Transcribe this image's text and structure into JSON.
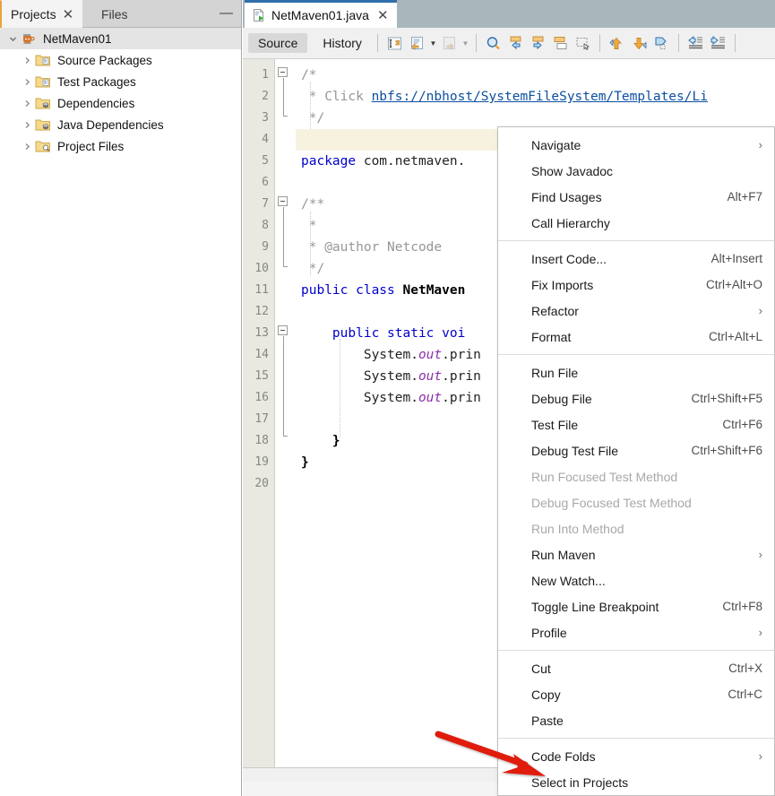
{
  "left_panel": {
    "tabs": [
      {
        "label": "Projects",
        "active": true,
        "closable": true
      },
      {
        "label": "Files",
        "active": false,
        "closable": false
      }
    ],
    "minimize_label": "—",
    "tree": {
      "root": {
        "label": "NetMaven01",
        "icon": "java-maven-project-icon",
        "expanded": true,
        "selected": true
      },
      "children": [
        {
          "label": "Source Packages",
          "icon": "source-packages-folder-icon",
          "expanded": false
        },
        {
          "label": "Test Packages",
          "icon": "test-packages-folder-icon",
          "expanded": false
        },
        {
          "label": "Dependencies",
          "icon": "dependencies-folder-icon",
          "expanded": false
        },
        {
          "label": "Java Dependencies",
          "icon": "java-dependencies-folder-icon",
          "expanded": false
        },
        {
          "label": "Project Files",
          "icon": "project-files-folder-icon",
          "expanded": false
        }
      ]
    }
  },
  "editor": {
    "tab": {
      "filename": "NetMaven01.java",
      "icon": "java-file-icon",
      "close_label": "×",
      "active": true
    },
    "toolbar": {
      "views": [
        {
          "label": "Source",
          "active": true
        },
        {
          "label": "History",
          "active": false
        }
      ],
      "icons": [
        {
          "name": "last-edit-icon",
          "disabled": false
        },
        {
          "name": "back-in-editor-icon",
          "disabled": false
        },
        {
          "name": "forward-in-editor-icon",
          "disabled": true
        },
        {
          "name": "find-selection-icon",
          "disabled": false
        },
        {
          "name": "find-previous-icon",
          "disabled": false
        },
        {
          "name": "find-next-icon",
          "disabled": false
        },
        {
          "name": "toggle-rect-selection-icon",
          "disabled": false
        },
        {
          "name": "previous-bookmark-icon",
          "disabled": false
        },
        {
          "name": "next-bookmark-icon",
          "disabled": false
        },
        {
          "name": "toggle-bookmark-icon",
          "disabled": false
        },
        {
          "name": "shift-line-left-icon",
          "disabled": false
        },
        {
          "name": "shift-line-right-icon",
          "disabled": false
        }
      ]
    },
    "gutter": {
      "line_numbers": [
        "1",
        "2",
        "3",
        "4",
        "5",
        "6",
        "7",
        "8",
        "9",
        "10",
        "11",
        "12",
        "13",
        "14",
        "15",
        "16",
        "17",
        "18",
        "19",
        "20"
      ]
    },
    "current_line": 4,
    "code_lines": [
      {
        "n": 1,
        "tokens": [
          {
            "t": "/*",
            "c": "cmt"
          }
        ]
      },
      {
        "n": 2,
        "tokens": [
          {
            "t": " * Click ",
            "c": "cmt"
          },
          {
            "t": "nbfs://nbhost/SystemFileSystem/Templates/Li",
            "c": "lnk"
          }
        ]
      },
      {
        "n": 3,
        "tokens": [
          {
            "t": " */",
            "c": "cmt"
          }
        ]
      },
      {
        "n": 4,
        "tokens": []
      },
      {
        "n": 5,
        "tokens": [
          {
            "t": "package",
            "c": "kw"
          },
          {
            "t": " com.netmaven.",
            "c": "plain"
          }
        ]
      },
      {
        "n": 6,
        "tokens": []
      },
      {
        "n": 7,
        "tokens": [
          {
            "t": "/**",
            "c": "cmt"
          }
        ]
      },
      {
        "n": 8,
        "tokens": [
          {
            "t": " *",
            "c": "cmt"
          }
        ]
      },
      {
        "n": 9,
        "tokens": [
          {
            "t": " * @author Netcode",
            "c": "cmt"
          }
        ]
      },
      {
        "n": 10,
        "tokens": [
          {
            "t": " */",
            "c": "cmt"
          }
        ]
      },
      {
        "n": 11,
        "tokens": [
          {
            "t": "public class ",
            "c": "kw"
          },
          {
            "t": "NetMaven",
            "c": "bold"
          }
        ]
      },
      {
        "n": 12,
        "tokens": []
      },
      {
        "n": 13,
        "tokens": [
          {
            "t": "    ",
            "c": "plain"
          },
          {
            "t": "public static voi",
            "c": "kw"
          }
        ]
      },
      {
        "n": 14,
        "tokens": [
          {
            "t": "        System.",
            "c": "plain"
          },
          {
            "t": "out",
            "c": "fld"
          },
          {
            "t": ".prin",
            "c": "plain"
          }
        ]
      },
      {
        "n": 15,
        "tokens": [
          {
            "t": "        System.",
            "c": "plain"
          },
          {
            "t": "out",
            "c": "fld"
          },
          {
            "t": ".prin",
            "c": "plain"
          }
        ]
      },
      {
        "n": 16,
        "tokens": [
          {
            "t": "        System.",
            "c": "plain"
          },
          {
            "t": "out",
            "c": "fld"
          },
          {
            "t": ".prin",
            "c": "plain"
          }
        ]
      },
      {
        "n": 17,
        "tokens": []
      },
      {
        "n": 18,
        "tokens": [
          {
            "t": "    }",
            "c": "bold"
          }
        ]
      },
      {
        "n": 19,
        "tokens": [
          {
            "t": "}",
            "c": "bold"
          }
        ]
      },
      {
        "n": 20,
        "tokens": []
      }
    ]
  },
  "context_menu": {
    "groups": [
      {
        "items": [
          {
            "label": "Navigate",
            "accel": "",
            "submenu": true,
            "disabled": false
          },
          {
            "label": "Show Javadoc",
            "accel": "",
            "submenu": false,
            "disabled": false
          },
          {
            "label": "Find Usages",
            "accel": "Alt+F7",
            "submenu": false,
            "disabled": false
          },
          {
            "label": "Call Hierarchy",
            "accel": "",
            "submenu": false,
            "disabled": false
          }
        ]
      },
      {
        "items": [
          {
            "label": "Insert Code...",
            "accel": "Alt+Insert",
            "submenu": false,
            "disabled": false
          },
          {
            "label": "Fix Imports",
            "accel": "Ctrl+Alt+O",
            "submenu": false,
            "disabled": false
          },
          {
            "label": "Refactor",
            "accel": "",
            "submenu": true,
            "disabled": false
          },
          {
            "label": "Format",
            "accel": "Ctrl+Alt+L",
            "submenu": false,
            "disabled": false
          }
        ]
      },
      {
        "items": [
          {
            "label": "Run File",
            "accel": "",
            "submenu": false,
            "disabled": false
          },
          {
            "label": "Debug File",
            "accel": "Ctrl+Shift+F5",
            "submenu": false,
            "disabled": false
          },
          {
            "label": "Test File",
            "accel": "Ctrl+F6",
            "submenu": false,
            "disabled": false
          },
          {
            "label": "Debug Test File",
            "accel": "Ctrl+Shift+F6",
            "submenu": false,
            "disabled": false
          },
          {
            "label": "Run Focused Test Method",
            "accel": "",
            "submenu": false,
            "disabled": true
          },
          {
            "label": "Debug Focused Test Method",
            "accel": "",
            "submenu": false,
            "disabled": true
          },
          {
            "label": "Run Into Method",
            "accel": "",
            "submenu": false,
            "disabled": true
          },
          {
            "label": "Run Maven",
            "accel": "",
            "submenu": true,
            "disabled": false
          },
          {
            "label": "New Watch...",
            "accel": "",
            "submenu": false,
            "disabled": false
          },
          {
            "label": "Toggle Line Breakpoint",
            "accel": "Ctrl+F8",
            "submenu": false,
            "disabled": false
          },
          {
            "label": "Profile",
            "accel": "",
            "submenu": true,
            "disabled": false
          }
        ]
      },
      {
        "items": [
          {
            "label": "Cut",
            "accel": "Ctrl+X",
            "submenu": false,
            "disabled": false
          },
          {
            "label": "Copy",
            "accel": "Ctrl+C",
            "submenu": false,
            "disabled": false
          },
          {
            "label": "Paste",
            "accel": "",
            "submenu": false,
            "disabled": false
          }
        ]
      },
      {
        "items": [
          {
            "label": "Code Folds",
            "accel": "",
            "submenu": true,
            "disabled": false
          },
          {
            "label": "Select in Projects",
            "accel": "",
            "submenu": false,
            "disabled": false,
            "highlighted_by_arrow": true
          }
        ]
      }
    ],
    "submenu_arrow_glyph": "›"
  },
  "annotation": {
    "arrow": {
      "name": "red-pointer-arrow",
      "color": "#e01b10",
      "points_at": "Select in Projects"
    }
  },
  "colors": {
    "tab_accent": "#2f6fab",
    "editor_tabstrip": "#a9b7bd",
    "gutter": "#e9e9e1",
    "current_line_highlight": "#f7f2e0",
    "keyword": "#0000cc",
    "comment": "#969696",
    "link": "#0b4fa0",
    "field": "#8b2fa8",
    "arrow_red": "#e01b10"
  }
}
